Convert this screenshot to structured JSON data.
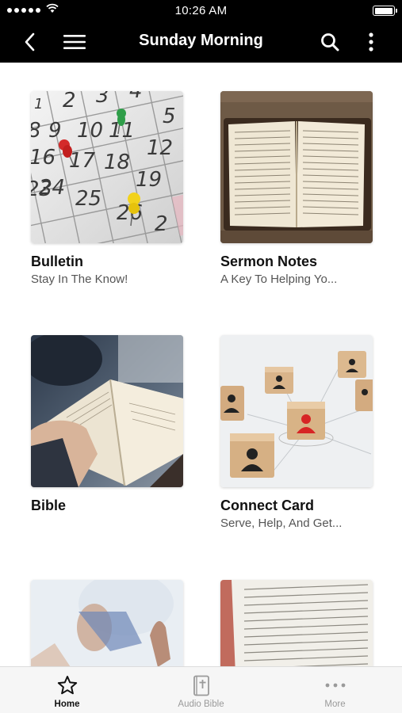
{
  "status_bar": {
    "time": "10:26 AM"
  },
  "header": {
    "title": "Sunday Morning",
    "back_icon": "chevron-left-icon",
    "menu_icon": "hamburger-icon",
    "search_icon": "search-icon",
    "more_icon": "vertical-dots-icon"
  },
  "cards": [
    {
      "title": "Bulletin",
      "subtitle": "Stay In The Know!",
      "image": "calendar-photo"
    },
    {
      "title": "Sermon Notes",
      "subtitle": " A Key To Helping Yo...",
      "image": "open-bible-photo"
    },
    {
      "title": "Bible",
      "subtitle": "",
      "image": "reading-bible-photo"
    },
    {
      "title": "Connect Card",
      "subtitle": "Serve, Help, And Get...",
      "image": "connect-blocks-photo"
    },
    {
      "title": "",
      "subtitle": "",
      "image": "worship-hands-photo"
    },
    {
      "title": "",
      "subtitle": "",
      "image": "bible-closeup-photo"
    }
  ],
  "tab_bar": {
    "tabs": [
      {
        "label": "Home",
        "icon": "star-icon",
        "active": true
      },
      {
        "label": "Audio Bible",
        "icon": "bible-icon",
        "active": false
      },
      {
        "label": "More",
        "icon": "horizontal-dots-icon",
        "active": false
      }
    ]
  },
  "colors": {
    "bar_background": "#000000",
    "tab_bar_background": "#f6f6f6",
    "text_primary": "#111111",
    "text_secondary": "#555555"
  }
}
